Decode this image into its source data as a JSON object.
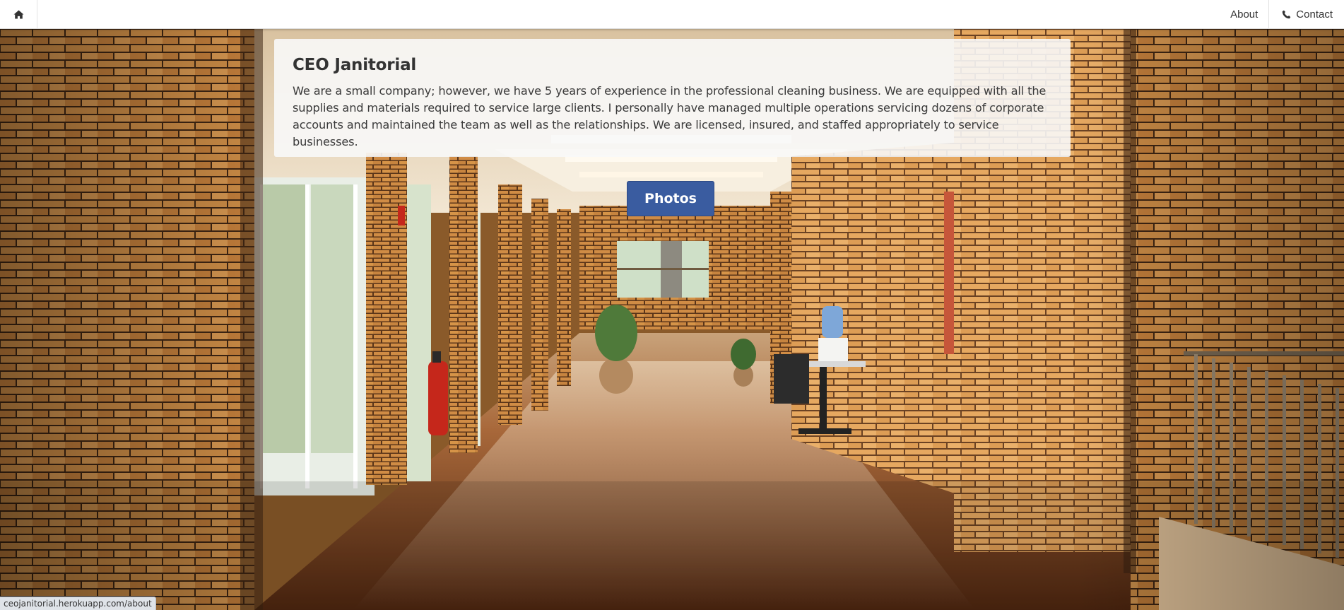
{
  "nav": {
    "home_icon": "home-icon",
    "about_label": "About",
    "contact_icon": "phone-icon",
    "contact_label": "Contact"
  },
  "about": {
    "title": "CEO Janitorial",
    "text": "We are a small company; however, we have 5 years of experience in the professional cleaning business. We are equipped with all the supplies and materials required to service large clients. I personally have managed multiple operations servicing dozens of corporate accounts and maintained the team as well as the relationships. We are licensed, insured, and staffed appropriately to service businesses."
  },
  "photos_button": {
    "label": "Photos",
    "color": "#3a5ca0"
  },
  "status_bar": {
    "url": "ceojanitorial.herokuapp.com/about"
  },
  "colors": {
    "navbar_bg": "#ffffff",
    "brick": "#c27a34",
    "floor": "#7a4218"
  }
}
